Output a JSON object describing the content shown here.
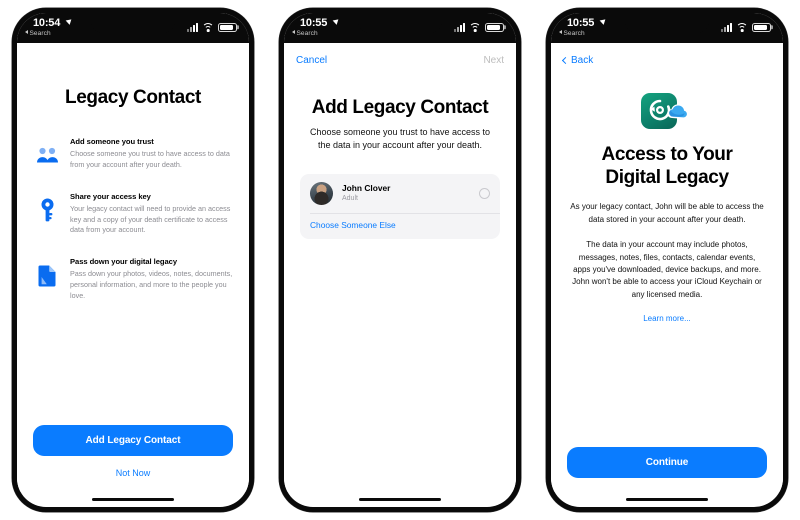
{
  "screens": [
    {
      "id": "legacy-contact-intro",
      "status_bar": {
        "time": "10:54",
        "back_label": "Search",
        "location_icon": "location-arrow-icon",
        "signal_icon": "cellular-signal-icon",
        "wifi_icon": "wifi-icon",
        "battery_icon": "battery-icon"
      },
      "title": "Legacy Contact",
      "features": [
        {
          "icon": "two-people-icon",
          "title": "Add someone you trust",
          "desc": "Choose someone you trust to have access to data from your account after your death."
        },
        {
          "icon": "key-icon",
          "title": "Share your access key",
          "desc": "Your legacy contact will need to provide an access key and a copy of your death certificate to access data from your account."
        },
        {
          "icon": "document-icon",
          "title": "Pass down your digital legacy",
          "desc": "Pass down your photos, videos, notes, documents, personal information, and more to the people you love."
        }
      ],
      "primary_button": "Add Legacy Contact",
      "secondary_button": "Not Now"
    },
    {
      "id": "add-legacy-contact",
      "status_bar": {
        "time": "10:55",
        "back_label": "Search",
        "location_icon": "location-arrow-icon",
        "signal_icon": "cellular-signal-icon",
        "wifi_icon": "wifi-icon",
        "battery_icon": "battery-icon"
      },
      "nav": {
        "left": "Cancel",
        "right": "Next"
      },
      "title": "Add Legacy Contact",
      "subtitle": "Choose someone you trust to have access to the data in your account after your death.",
      "contact": {
        "name": "John Clover",
        "meta": "Adult",
        "avatar": "contact-avatar",
        "selector": "radio-unselected-icon"
      },
      "choose_other": "Choose Someone Else"
    },
    {
      "id": "access-to-digital-legacy",
      "status_bar": {
        "time": "10:55",
        "back_label": "Search",
        "location_icon": "location-arrow-icon",
        "signal_icon": "cellular-signal-icon",
        "wifi_icon": "wifi-icon",
        "battery_icon": "battery-icon"
      },
      "nav": {
        "left": "Back"
      },
      "hero_icon": "digital-legacy-icloud-icon",
      "title_line1": "Access to Your",
      "title_line2": "Digital Legacy",
      "paragraph1": "As your legacy contact, John will be able to access the data stored in your account after your death.",
      "paragraph2": "The data in your account may include photos, messages, notes, files, contacts, calendar events, apps you've downloaded, device backups, and more. John won't be able to access your iCloud Keychain or any licensed media.",
      "learn_more": "Learn more...",
      "primary_button": "Continue"
    }
  ],
  "colors": {
    "accent": "#0a7cff",
    "muted_text": "#8c8c92",
    "card_bg": "#f4f4f6",
    "icon_green": "#0d7f6a"
  }
}
